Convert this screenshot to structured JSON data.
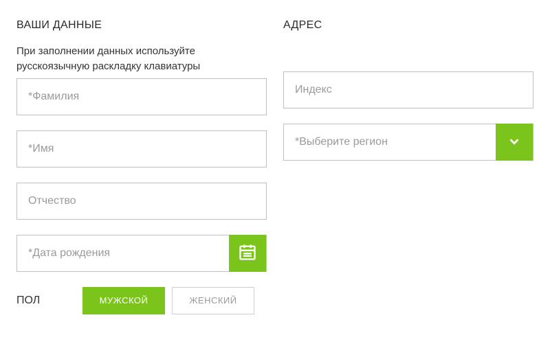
{
  "left": {
    "heading": "ВАШИ ДАННЫЕ",
    "helper": "При заполнении данных используйте русскоязычную раскладку клавиатуры",
    "surname_placeholder": "*Фамилия",
    "name_placeholder": "*Имя",
    "patronymic_placeholder": "Отчество",
    "dob_placeholder": "*Дата рождения",
    "gender_label": "ПОЛ",
    "gender_male": "МУЖСКОЙ",
    "gender_female": "ЖЕНСКИЙ"
  },
  "right": {
    "heading": "АДРЕС",
    "index_placeholder": "Индекс",
    "region_placeholder": "*Выберите регион"
  }
}
